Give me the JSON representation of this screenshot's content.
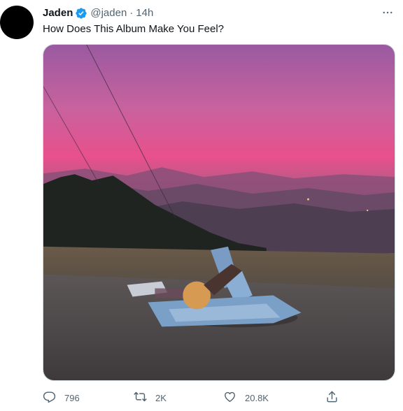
{
  "tweet": {
    "display_name": "Jaden",
    "handle": "@jaden",
    "separator": "·",
    "time": "14h",
    "text": "How Does This Album Make You Feel?",
    "verified": true
  },
  "media": {
    "kind": "photo",
    "alt_hint": "person lying on road at sunset overlooking hills"
  },
  "actions": {
    "reply_count": "796",
    "retweet_count": "2K",
    "like_count": "20.8K"
  },
  "icons": {
    "verified": "verified-badge-icon",
    "more": "more-dots-icon",
    "reply": "reply-icon",
    "retweet": "retweet-icon",
    "like": "heart-icon",
    "share": "share-icon"
  },
  "colors": {
    "verified_blue": "#1d9bf0",
    "muted_text": "#536471",
    "primary_text": "#0f1419"
  }
}
